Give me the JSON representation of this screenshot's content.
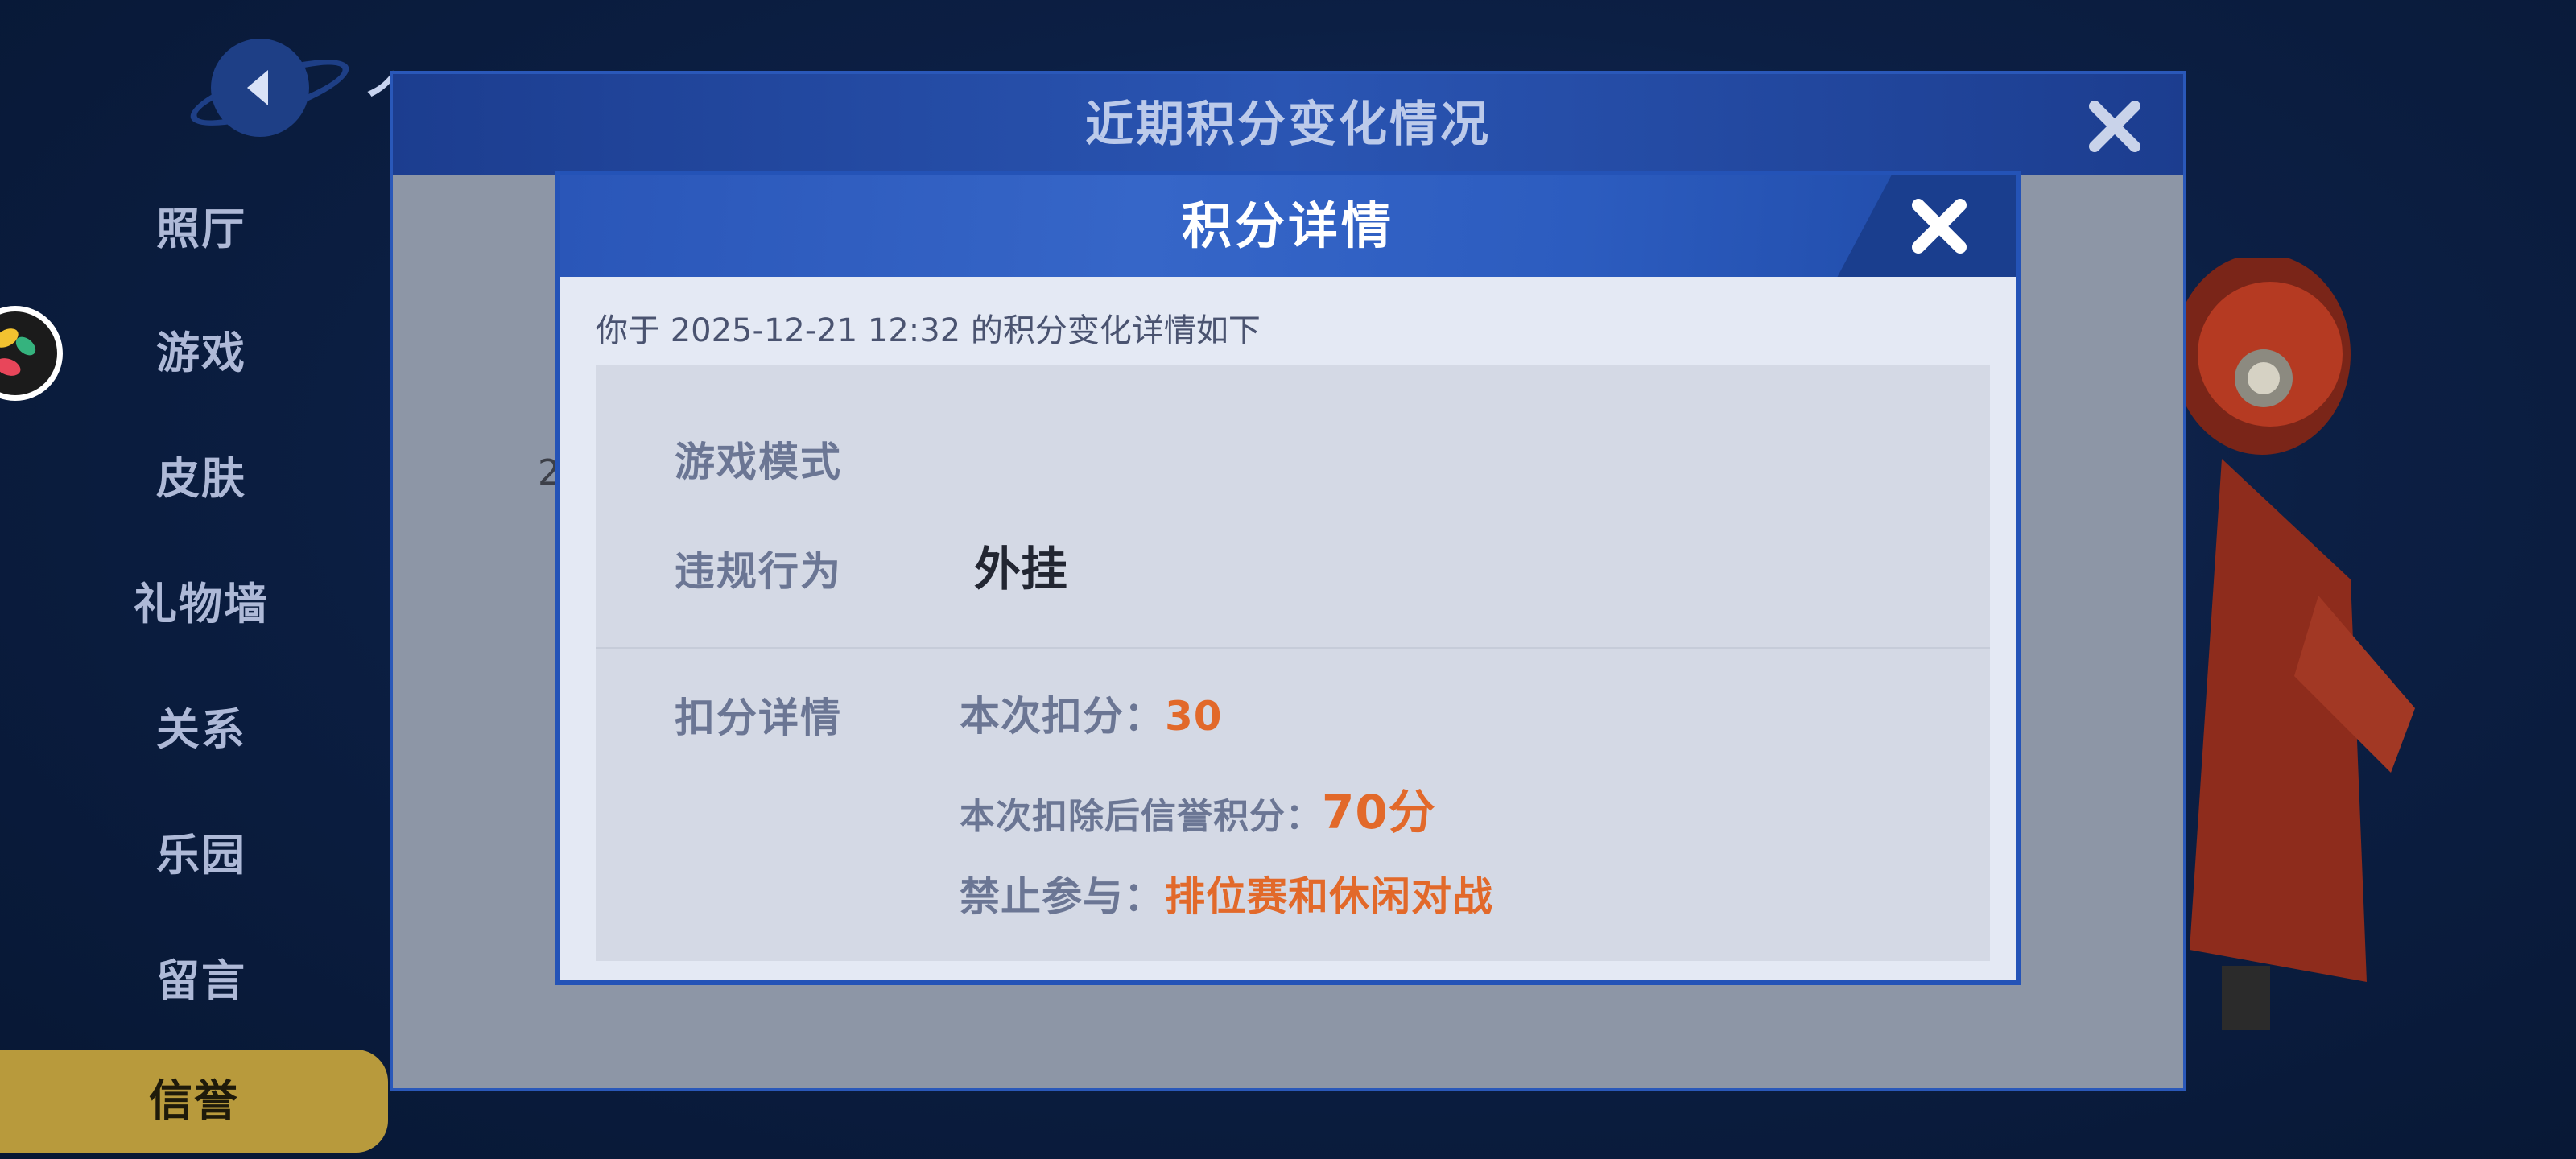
{
  "background": {
    "page_title": "个人主页",
    "more_glyph": "»",
    "nav_items": [
      {
        "label": "照厅",
        "active": false
      },
      {
        "label": "游戏",
        "active": false
      },
      {
        "label": "皮肤",
        "active": false
      },
      {
        "label": "礼物墙",
        "active": false
      },
      {
        "label": "关系",
        "active": false
      },
      {
        "label": "乐园",
        "active": false
      },
      {
        "label": "留言",
        "active": false
      },
      {
        "label": "信誉",
        "active": true
      }
    ],
    "partial_row_text": "2"
  },
  "outer_dialog": {
    "title": "近期积分变化情况",
    "close_icon": "close-icon"
  },
  "inner_dialog": {
    "title": "积分详情",
    "close_icon": "close-icon",
    "intro": "你于 2025-12-21 12:32 的积分变化详情如下",
    "game_mode_label": "游戏模式",
    "game_mode_value": "",
    "violation_label": "违规行为",
    "violation_value": "外挂",
    "deduction_label": "扣分详情",
    "deduction_points_label": "本次扣分：",
    "deduction_points_value": "30",
    "remaining_label": "本次扣除后信誉积分：",
    "remaining_value": "70分",
    "banned_label": "禁止参与：",
    "banned_value": "排位赛和休闲对战"
  },
  "colors": {
    "accent_orange": "#e2692a",
    "header_blue": "#2a56b8",
    "active_nav": "#b89a3c"
  }
}
